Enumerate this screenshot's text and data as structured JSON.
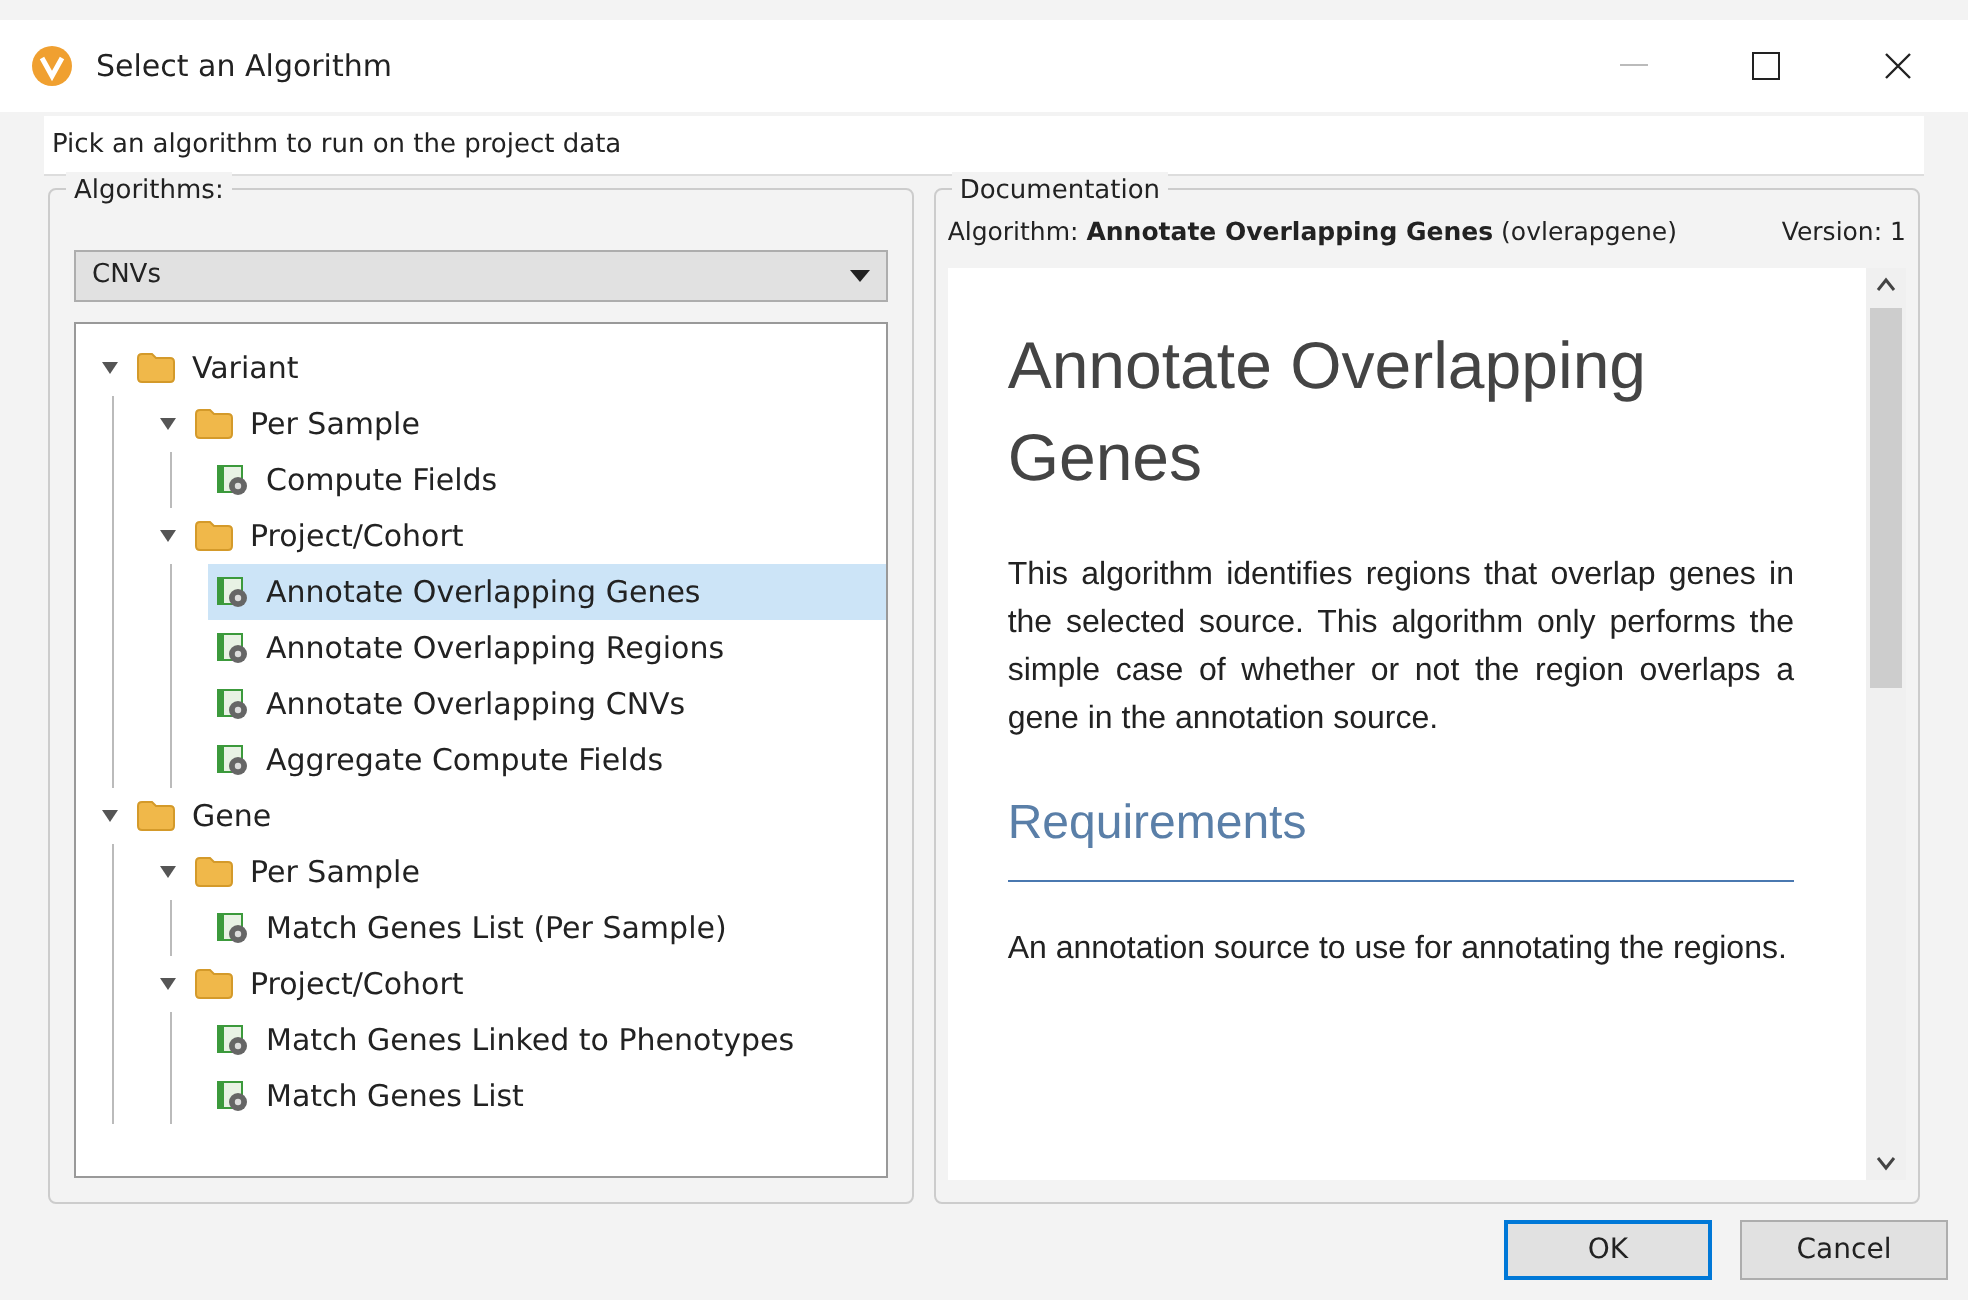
{
  "window": {
    "title": "Select an Algorithm"
  },
  "instruction": "Pick an algorithm to run on the project data",
  "algorithms": {
    "label": "Algorithms:",
    "dropdown": {
      "value": "CNVs"
    },
    "tree": [
      {
        "kind": "folder",
        "label": "Variant",
        "expanded": true,
        "children": [
          {
            "kind": "folder",
            "label": "Per Sample",
            "expanded": true,
            "children": [
              {
                "kind": "algorithm",
                "label": "Compute Fields",
                "selected": false
              }
            ]
          },
          {
            "kind": "folder",
            "label": "Project/Cohort",
            "expanded": true,
            "children": [
              {
                "kind": "algorithm",
                "label": "Annotate Overlapping Genes",
                "selected": true
              },
              {
                "kind": "algorithm",
                "label": "Annotate Overlapping Regions",
                "selected": false
              },
              {
                "kind": "algorithm",
                "label": "Annotate Overlapping CNVs",
                "selected": false
              },
              {
                "kind": "algorithm",
                "label": "Aggregate Compute Fields",
                "selected": false
              }
            ]
          }
        ]
      },
      {
        "kind": "folder",
        "label": "Gene",
        "expanded": true,
        "children": [
          {
            "kind": "folder",
            "label": "Per Sample",
            "expanded": true,
            "children": [
              {
                "kind": "algorithm",
                "label": "Match Genes List (Per Sample)",
                "selected": false
              }
            ]
          },
          {
            "kind": "folder",
            "label": "Project/Cohort",
            "expanded": true,
            "children": [
              {
                "kind": "algorithm",
                "label": "Match Genes Linked to Phenotypes",
                "selected": false
              },
              {
                "kind": "algorithm",
                "label": "Match Genes List",
                "selected": false
              }
            ]
          }
        ]
      }
    ]
  },
  "documentation": {
    "label": "Documentation",
    "algorithm_line": "Algorithm: **Annotate Overlapping Genes** (ovlerapgene)",
    "version": "Version: 1",
    "heading": "Annotate Overlapping Genes",
    "intro": "This algorithm identifies regions that overlap genes in the selected source. This algorithm only performs the simple case of whether or not the region overlaps a gene in the annotation source.",
    "subheading": "Requirements",
    "requirements": "An annotation source to use for annotating the regions."
  },
  "buttons": [
    {
      "label": "OK",
      "default": true
    },
    {
      "label": "Cancel",
      "default": false
    }
  ]
}
